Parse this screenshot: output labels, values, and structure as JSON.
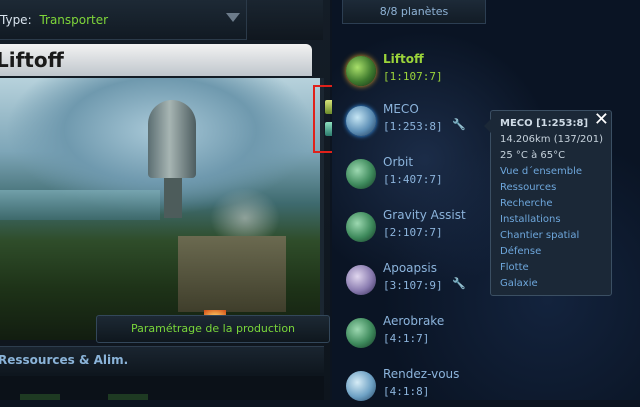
{
  "fleet": {
    "type_label": "Type:",
    "type_value": "Transporter"
  },
  "planet_panel": {
    "title": "Liftoff",
    "production_button": "Paramétrage de la production",
    "section_title": "Ressources & Alim."
  },
  "planet_list": {
    "count": "8/8 planètes",
    "planets": [
      {
        "name": "Liftoff",
        "coords": "[1:107:7]"
      },
      {
        "name": "MECO",
        "coords": "[1:253:8]"
      },
      {
        "name": "Orbit",
        "coords": "[1:407:7]"
      },
      {
        "name": "Gravity Assist",
        "coords": "[2:107:7]"
      },
      {
        "name": "Apoapsis",
        "coords": "[3:107:9]"
      },
      {
        "name": "Aerobrake",
        "coords": "[4:1:7]"
      },
      {
        "name": "Rendez-vous",
        "coords": "[4:1:8]"
      }
    ]
  },
  "tooltip": {
    "title": "MECO [1:253:8]",
    "size": "14.206km (137/201)",
    "temperature": "25 °C à 65°C",
    "links": [
      "Vue d´ensemble",
      "Ressources",
      "Recherche",
      "Installations",
      "Chantier spatial",
      "Défense",
      "Flotte",
      "Galaxie"
    ],
    "close_glyph": "✕"
  },
  "icons": {
    "wrench": "🔧",
    "dropdown": "chevron-down-icon"
  },
  "colors": {
    "accent_green": "#9bd43a",
    "link_blue": "#6ea7dc",
    "highlight_box": "#e0211a"
  }
}
